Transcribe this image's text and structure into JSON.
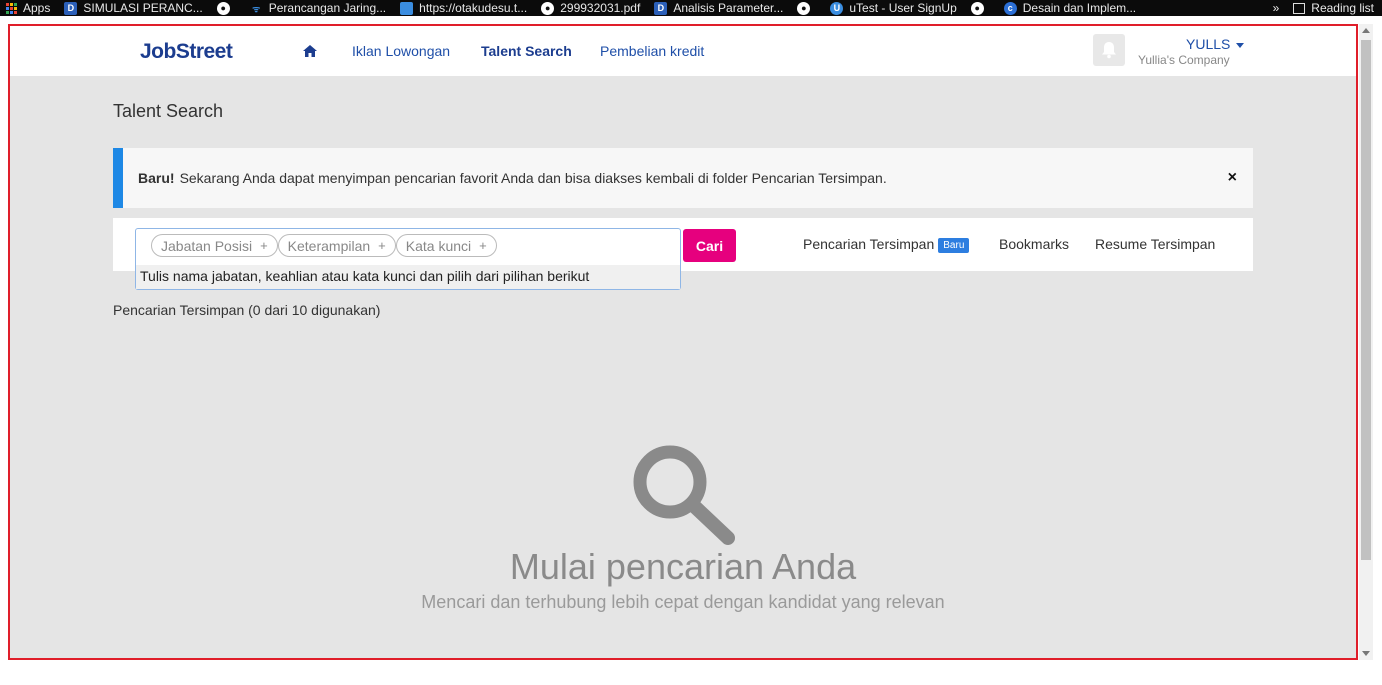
{
  "bookmarks": [
    {
      "label": "Apps",
      "icon": "apps-icon"
    },
    {
      "label": "SIMULASI PERANC...",
      "icon": "d-icon"
    },
    {
      "label": "",
      "icon": "globe-icon"
    },
    {
      "label": "Perancangan Jaring...",
      "icon": "wifi-icon"
    },
    {
      "label": "https://otakudesu.t...",
      "icon": "doc-icon"
    },
    {
      "label": "299932031.pdf",
      "icon": "globe-icon"
    },
    {
      "label": "Analisis Parameter...",
      "icon": "d-icon"
    },
    {
      "label": "",
      "icon": "globe-icon"
    },
    {
      "label": "uTest - User SignUp",
      "icon": "u-icon"
    },
    {
      "label": "",
      "icon": "globe-icon"
    },
    {
      "label": "Desain dan Implem...",
      "icon": "c-icon"
    }
  ],
  "bookmarks_more": "»",
  "reading_list": "Reading list",
  "nav": {
    "logo": "JobStreet",
    "links": [
      "Iklan Lowongan",
      "Talent Search",
      "Pembelian kredit"
    ],
    "user_name": "YULLS",
    "company": "Yullia's Company"
  },
  "page_title": "Talent Search",
  "banner": {
    "bold": "Baru!",
    "text": "Sekarang Anda dapat menyimpan pencarian favorit Anda dan bisa diakses kembali di folder Pencarian Tersimpan.",
    "close": "×"
  },
  "search": {
    "chips": [
      "Jabatan Posisi",
      "Keterampilan",
      "Kata kunci"
    ],
    "chip_add": "+",
    "suggestion": "Tulis nama jabatan, keahlian atau kata kunci dan pilih dari pilihan berikut",
    "button": "Cari",
    "saved_link": "Pencarian Tersimpan",
    "saved_badge": "Baru",
    "bookmarks_link": "Bookmarks",
    "resume_link": "Resume Tersimpan"
  },
  "saved_count": "Pencarian Tersimpan (0 dari 10 digunakan)",
  "empty": {
    "title": "Mulai pencarian Anda",
    "subtitle": "Mencari dan terhubung lebih cepat dengan kandidat yang relevan"
  },
  "colors": {
    "brand_navy": "#1c3d8f",
    "link_blue": "#1f4fa8",
    "accent_pink": "#e6007e",
    "banner_blue": "#1e88e5",
    "highlight_border": "#e01e2a"
  }
}
